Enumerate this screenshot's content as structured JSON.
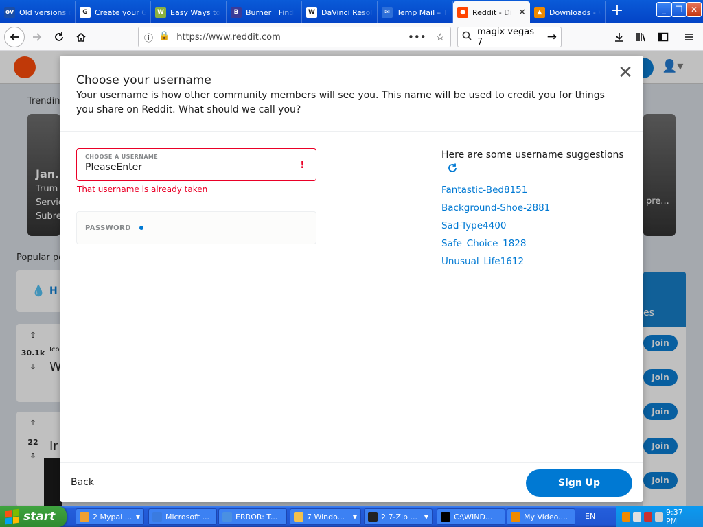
{
  "browser": {
    "tabs": [
      {
        "label": "Old versions of",
        "icon": "oldversion-icon",
        "favtext": "ov",
        "color": "#1a4ea7"
      },
      {
        "label": "Create your Go",
        "icon": "google-icon",
        "favtext": "G",
        "color": "#ffffff"
      },
      {
        "label": "Easy Ways to",
        "icon": "wikihow-icon",
        "favtext": "W",
        "color": "#8bb040"
      },
      {
        "label": "Burner | Find",
        "icon": "burner-icon",
        "favtext": "B",
        "color": "#3b3b98"
      },
      {
        "label": "DaVinci Resolv",
        "icon": "wikipedia-icon",
        "favtext": "W",
        "color": "#ffffff"
      },
      {
        "label": "Temp Mail – Th",
        "icon": "tempmail-icon",
        "favtext": "✉",
        "color": "#2e6fd8"
      },
      {
        "label": "Reddit - Di",
        "icon": "reddit-icon",
        "favtext": "●",
        "color": "#ff4500"
      },
      {
        "label": "Downloads - V",
        "icon": "vlc-icon",
        "favtext": "▲",
        "color": "#f08a00"
      }
    ],
    "url": "https://www.reddit.com",
    "search_text": "magix vegas 7"
  },
  "background": {
    "trending_label": "Trendin",
    "trend_card_title": "Jan.",
    "trend_card_line1": "Trum",
    "trend_card_line2": "Servic",
    "trend_card_sub": "Subre",
    "trend_card_right": "pre...",
    "popular_label": "Popular po",
    "hot_label": "H",
    "post1_votes": "30.1k",
    "post1_author": "Ico",
    "post1_title": "W",
    "post2_votes": "22",
    "post2_title": "Ir",
    "side_card_text": "es",
    "join_label": "Join"
  },
  "modal": {
    "title": "Choose your username",
    "description": "Your username is how other community members will see you. This name will be used to credit you for things you share on Reddit. What should we call you?",
    "username_label": "CHOOSE A USERNAME",
    "username_value": "PleaseEnter",
    "username_error": "That username is already taken",
    "password_label": "PASSWORD",
    "suggestions_title": "Here are some username suggestions",
    "suggestions": [
      "Fantastic-Bed8151",
      "Background-Shoe-2881",
      "Sad-Type4400",
      "Safe_Choice_1828",
      "Unusual_Life1612"
    ],
    "back_label": "Back",
    "signup_label": "Sign Up",
    "accent_color": "#0079d3",
    "error_color": "#ea0027"
  },
  "taskbar": {
    "start_label": "start",
    "tasks": [
      {
        "label": "2 Mypal ...",
        "has_arrow": true
      },
      {
        "label": "Microsoft ...",
        "has_arrow": false
      },
      {
        "label": "ERROR: T...",
        "has_arrow": false
      },
      {
        "label": "7 Windo...",
        "has_arrow": true
      },
      {
        "label": "2 7-Zip ...",
        "has_arrow": true
      },
      {
        "label": "C:\\WIND...",
        "has_arrow": false
      },
      {
        "label": "My Video....",
        "has_arrow": false
      }
    ],
    "language": "EN",
    "clock": "9:37 PM"
  }
}
